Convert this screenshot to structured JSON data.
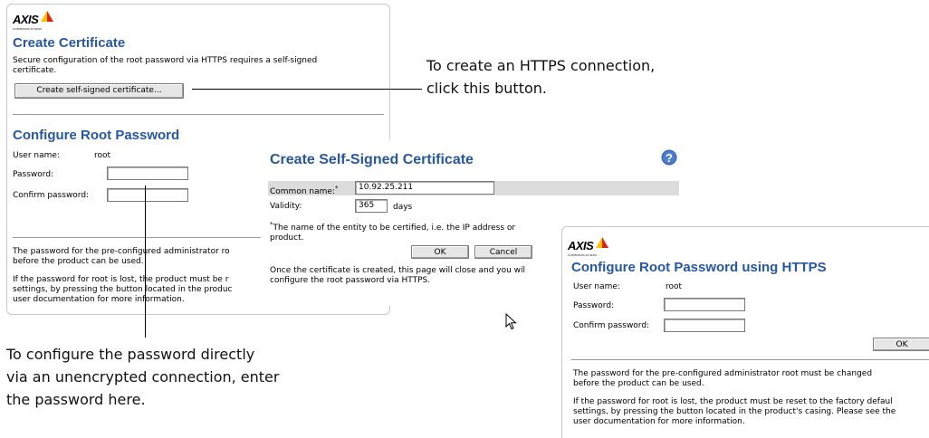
{
  "logo": {
    "text": "AXIS",
    "subtext": "COMMUNICATIONS"
  },
  "main_panel": {
    "create_cert_title": "Create Certificate",
    "create_cert_desc": "Secure configuration of the root password via HTTPS requires a self-signed certificate.",
    "create_cert_button": "Create self-signed certificate...",
    "root_pw_title": "Configure Root Password",
    "user_name_label": "User name:",
    "user_name_value": "root",
    "password_label": "Password:",
    "confirm_label": "Confirm password:",
    "info_1": "The password for the pre-configured administrator ro",
    "info_1b": "before the product can be used.",
    "info_2": "If the password for root is lost, the product must be r",
    "info_2b": "settings, by pressing the button located in the produc",
    "info_2c": "user documentation for more information."
  },
  "cert_dialog": {
    "title": "Create Self-Signed Certificate",
    "help_icon": "?",
    "common_name_label": "Common name:",
    "common_name_mark": "*",
    "common_name_value": "10.92.25.211",
    "validity_label": "Validity:",
    "validity_value": "365",
    "validity_unit": "days",
    "footnote_mark": "*",
    "footnote_1": "The name of the entity to be certified, i.e. the IP address or",
    "footnote_2": "product.",
    "ok_button": "OK",
    "cancel_button": "Cancel",
    "note_1": "Once the certificate is created, this page will close and you wil",
    "note_2": "configure the root password via HTTPS."
  },
  "https_dialog": {
    "title": "Configure Root Password using HTTPS",
    "user_name_label": "User name:",
    "user_name_value": "root",
    "password_label": "Password:",
    "confirm_label": "Confirm password:",
    "ok_button": "OK",
    "info_1": "The password for the pre-configured administrator root must be changed",
    "info_1b": "before the product can be used.",
    "info_2": "If the password for root is lost, the product must be reset to the factory defaul",
    "info_2b": "settings, by pressing the button located in the product's casing. Please see the",
    "info_2c": "user documentation for more information."
  },
  "callouts": {
    "https_1": "To create an HTTPS connection,",
    "https_2": "click this button.",
    "direct_1": "To configure the password directly",
    "direct_2": "via an unencrypted connection, enter",
    "direct_3": "the password here."
  },
  "colors": {
    "heading": "#27579f",
    "logo_triangle_yellow": "#f5c400",
    "logo_triangle_red": "#e2231a",
    "help_icon": "#3a68b5"
  }
}
